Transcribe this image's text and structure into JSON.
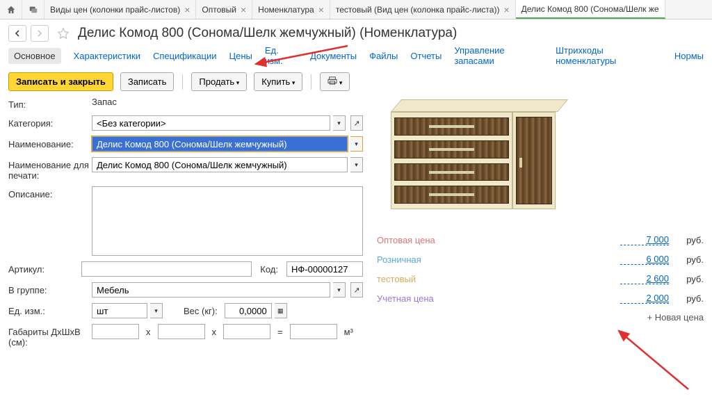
{
  "tabs": [
    {
      "label": "Виды цен (колонки прайс-листов)"
    },
    {
      "label": "Оптовый"
    },
    {
      "label": "Номенклатура"
    },
    {
      "label": "тестовый (Вид цен (колонка прайс-листа))"
    },
    {
      "label": "Делис Комод 800 (Сонома/Шелк же"
    }
  ],
  "title": "Делис Комод 800 (Сонома/Шелк жемчужный) (Номенклатура)",
  "nav_links": {
    "main": "Основное",
    "chars": "Характеристики",
    "specs": "Спецификации",
    "prices": "Цены",
    "units": "Ед. изм.",
    "docs": "Документы",
    "files": "Файлы",
    "reports": "Отчеты",
    "stock": "Управление запасами",
    "barcodes": "Штрихкоды номенклатуры",
    "norms": "Нормы"
  },
  "actions": {
    "save_close": "Записать и закрыть",
    "save": "Записать",
    "sell": "Продать",
    "buy": "Купить"
  },
  "form": {
    "type_label": "Тип:",
    "type_value": "Запас",
    "category_label": "Категория:",
    "category_value": "<Без категории>",
    "name_label": "Наименование:",
    "name_value": "Делис Комод 800 (Сонома/Шелк жемчужный)",
    "printname_label": "Наименование для печати:",
    "printname_value": "Делис Комод 800 (Сонома/Шелк жемчужный)",
    "desc_label": "Описание:",
    "desc_value": "",
    "article_label": "Артикул:",
    "article_value": "",
    "code_label": "Код:",
    "code_value": "НФ-00000127",
    "group_label": "В группе:",
    "group_value": "Мебель",
    "unit_label": "Ед. изм.:",
    "unit_value": "шт",
    "weight_label": "Вес (кг):",
    "weight_value": "0,0000",
    "dims_label": "Габариты ДхШхВ (см):",
    "dims_x": "x",
    "dims_eq": "=",
    "dims_unit": "м³"
  },
  "prices": [
    {
      "label": "Оптовая цена",
      "color": "#d87878",
      "value": "7 000",
      "currency": "руб."
    },
    {
      "label": "Розничная",
      "color": "#5aa8d8",
      "value": "6 000",
      "currency": "руб."
    },
    {
      "label": "тестовый",
      "color": "#d8a858",
      "value": "2 600",
      "currency": "руб."
    },
    {
      "label": "Учетная цена",
      "color": "#9878d8",
      "value": "2 000",
      "currency": "руб."
    }
  ],
  "new_price": "+ Новая цена"
}
